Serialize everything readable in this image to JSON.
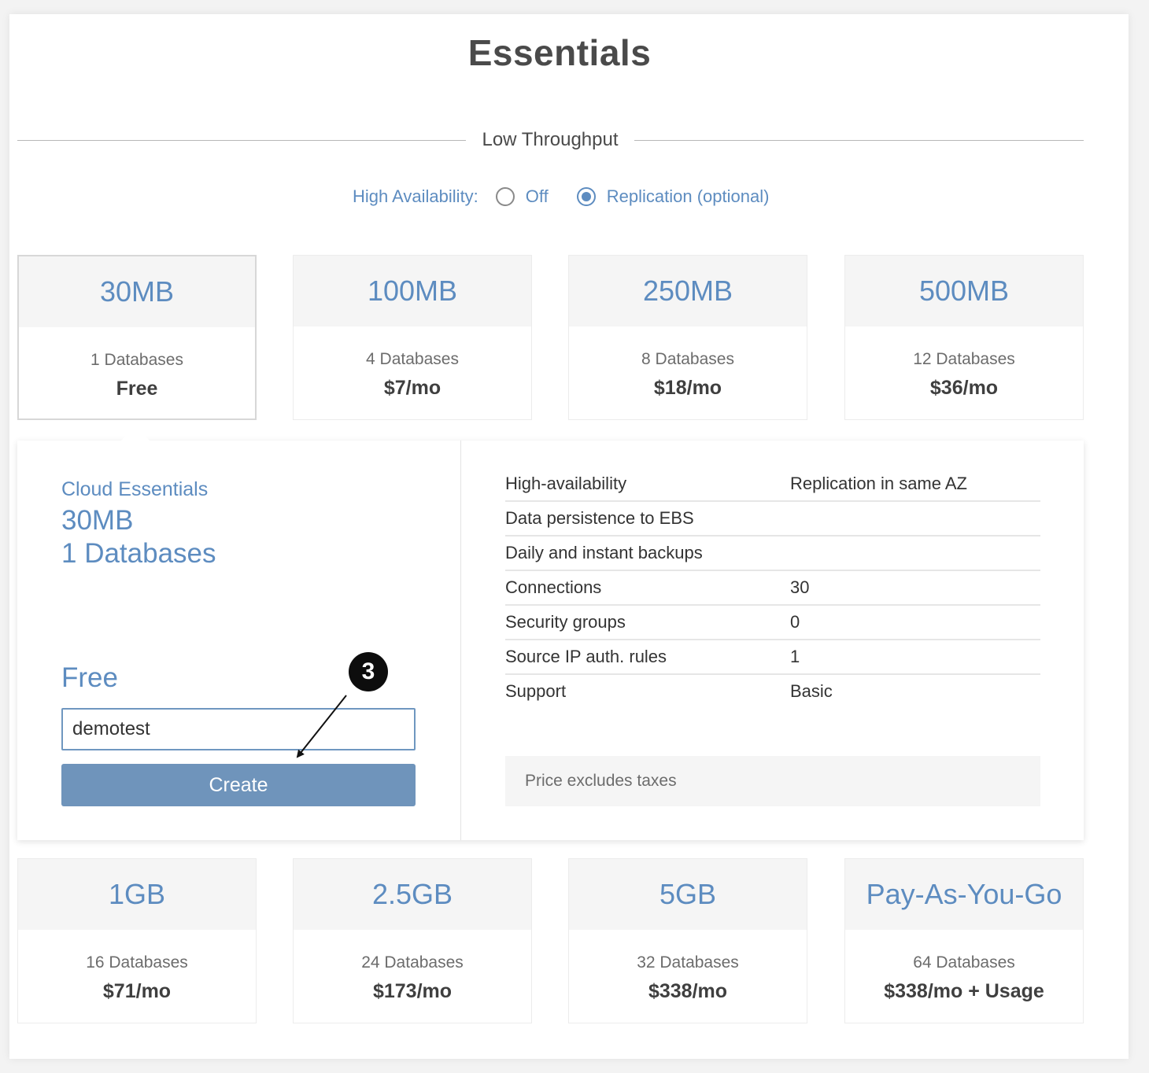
{
  "title": "Essentials",
  "section_label": "Low Throughput",
  "high_availability": {
    "label": "High Availability:",
    "options": [
      {
        "label": "Off",
        "selected": false
      },
      {
        "label": "Replication (optional)",
        "selected": true
      }
    ]
  },
  "plans_top": [
    {
      "size": "30MB",
      "databases": "1 Databases",
      "price": "Free",
      "selected": true
    },
    {
      "size": "100MB",
      "databases": "4 Databases",
      "price": "$7/mo",
      "selected": false
    },
    {
      "size": "250MB",
      "databases": "8 Databases",
      "price": "$18/mo",
      "selected": false
    },
    {
      "size": "500MB",
      "databases": "12 Databases",
      "price": "$36/mo",
      "selected": false
    }
  ],
  "plans_bottom": [
    {
      "size": "1GB",
      "databases": "16 Databases",
      "price": "$71/mo"
    },
    {
      "size": "2.5GB",
      "databases": "24 Databases",
      "price": "$173/mo"
    },
    {
      "size": "5GB",
      "databases": "32 Databases",
      "price": "$338/mo"
    },
    {
      "size": "Pay-As-You-Go",
      "databases": "64 Databases",
      "price": "$338/mo + Usage"
    }
  ],
  "detail": {
    "plan_name": "Cloud Essentials",
    "size": "30MB",
    "databases": "1 Databases",
    "price": "Free",
    "name_input_value": "demotest",
    "create_label": "Create",
    "features": [
      {
        "name": "High-availability",
        "value": "Replication in same AZ"
      },
      {
        "name": "Data persistence to EBS",
        "value": ""
      },
      {
        "name": "Daily and instant backups",
        "value": ""
      },
      {
        "name": "Connections",
        "value": "30"
      },
      {
        "name": "Security groups",
        "value": "0"
      },
      {
        "name": "Source IP auth. rules",
        "value": "1"
      },
      {
        "name": "Support",
        "value": "Basic"
      }
    ],
    "note": "Price excludes taxes"
  },
  "annotation_marker": "3"
}
